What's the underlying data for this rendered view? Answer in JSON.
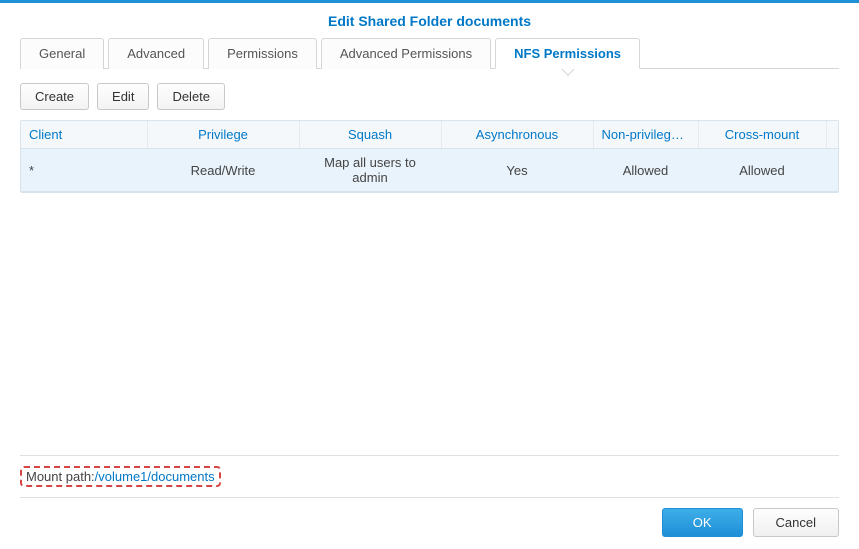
{
  "title": "Edit Shared Folder documents",
  "tabs": {
    "general": "General",
    "advanced": "Advanced",
    "permissions": "Permissions",
    "advanced_permissions": "Advanced Permissions",
    "nfs_permissions": "NFS Permissions"
  },
  "toolbar": {
    "create": "Create",
    "edit": "Edit",
    "delete": "Delete"
  },
  "table": {
    "headers": {
      "client": "Client",
      "privilege": "Privilege",
      "squash": "Squash",
      "asynchronous": "Asynchronous",
      "non_privileged": "Non-privileged …",
      "cross_mount": "Cross-mount"
    },
    "rows": [
      {
        "client": "*",
        "privilege": "Read/Write",
        "squash": "Map all users to admin",
        "asynchronous": "Yes",
        "non_privileged": "Allowed",
        "cross_mount": "Allowed"
      }
    ]
  },
  "mount": {
    "label": "Mount path:",
    "path": "/volume1/documents"
  },
  "footer": {
    "ok": "OK",
    "cancel": "Cancel"
  }
}
